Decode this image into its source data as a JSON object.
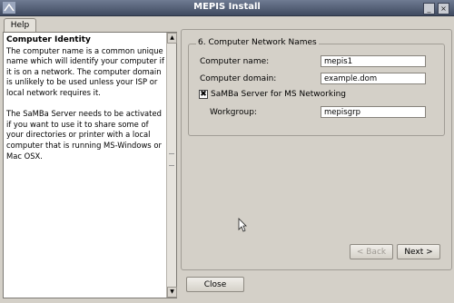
{
  "window": {
    "title": "MEPIS Install"
  },
  "tabs": [
    {
      "label": "Help"
    }
  ],
  "help": {
    "heading": "Computer Identity",
    "para1": "The computer name is a common unique name which will identify your computer if it is on a network. The computer domain is unlikely to be used unless your ISP or local network requires it.",
    "para2": "The SaMBa Server needs to be activated if you want to use it to share some of your directories or printer with a local computer that is running MS-Windows or Mac OSX."
  },
  "network": {
    "group_title": "6. Computer Network Names",
    "name_label": "Computer name:",
    "name_value": "mepis1",
    "domain_label": "Computer domain:",
    "domain_value": "example.dom",
    "samba_label": "SaMBa Server for MS Networking",
    "samba_checked": true,
    "samba_mark": "✖",
    "workgroup_label": "Workgroup:",
    "workgroup_value": "mepisgrp"
  },
  "nav": {
    "back_label": "< Back",
    "next_label": "Next >"
  },
  "footer": {
    "close_label": "Close"
  }
}
